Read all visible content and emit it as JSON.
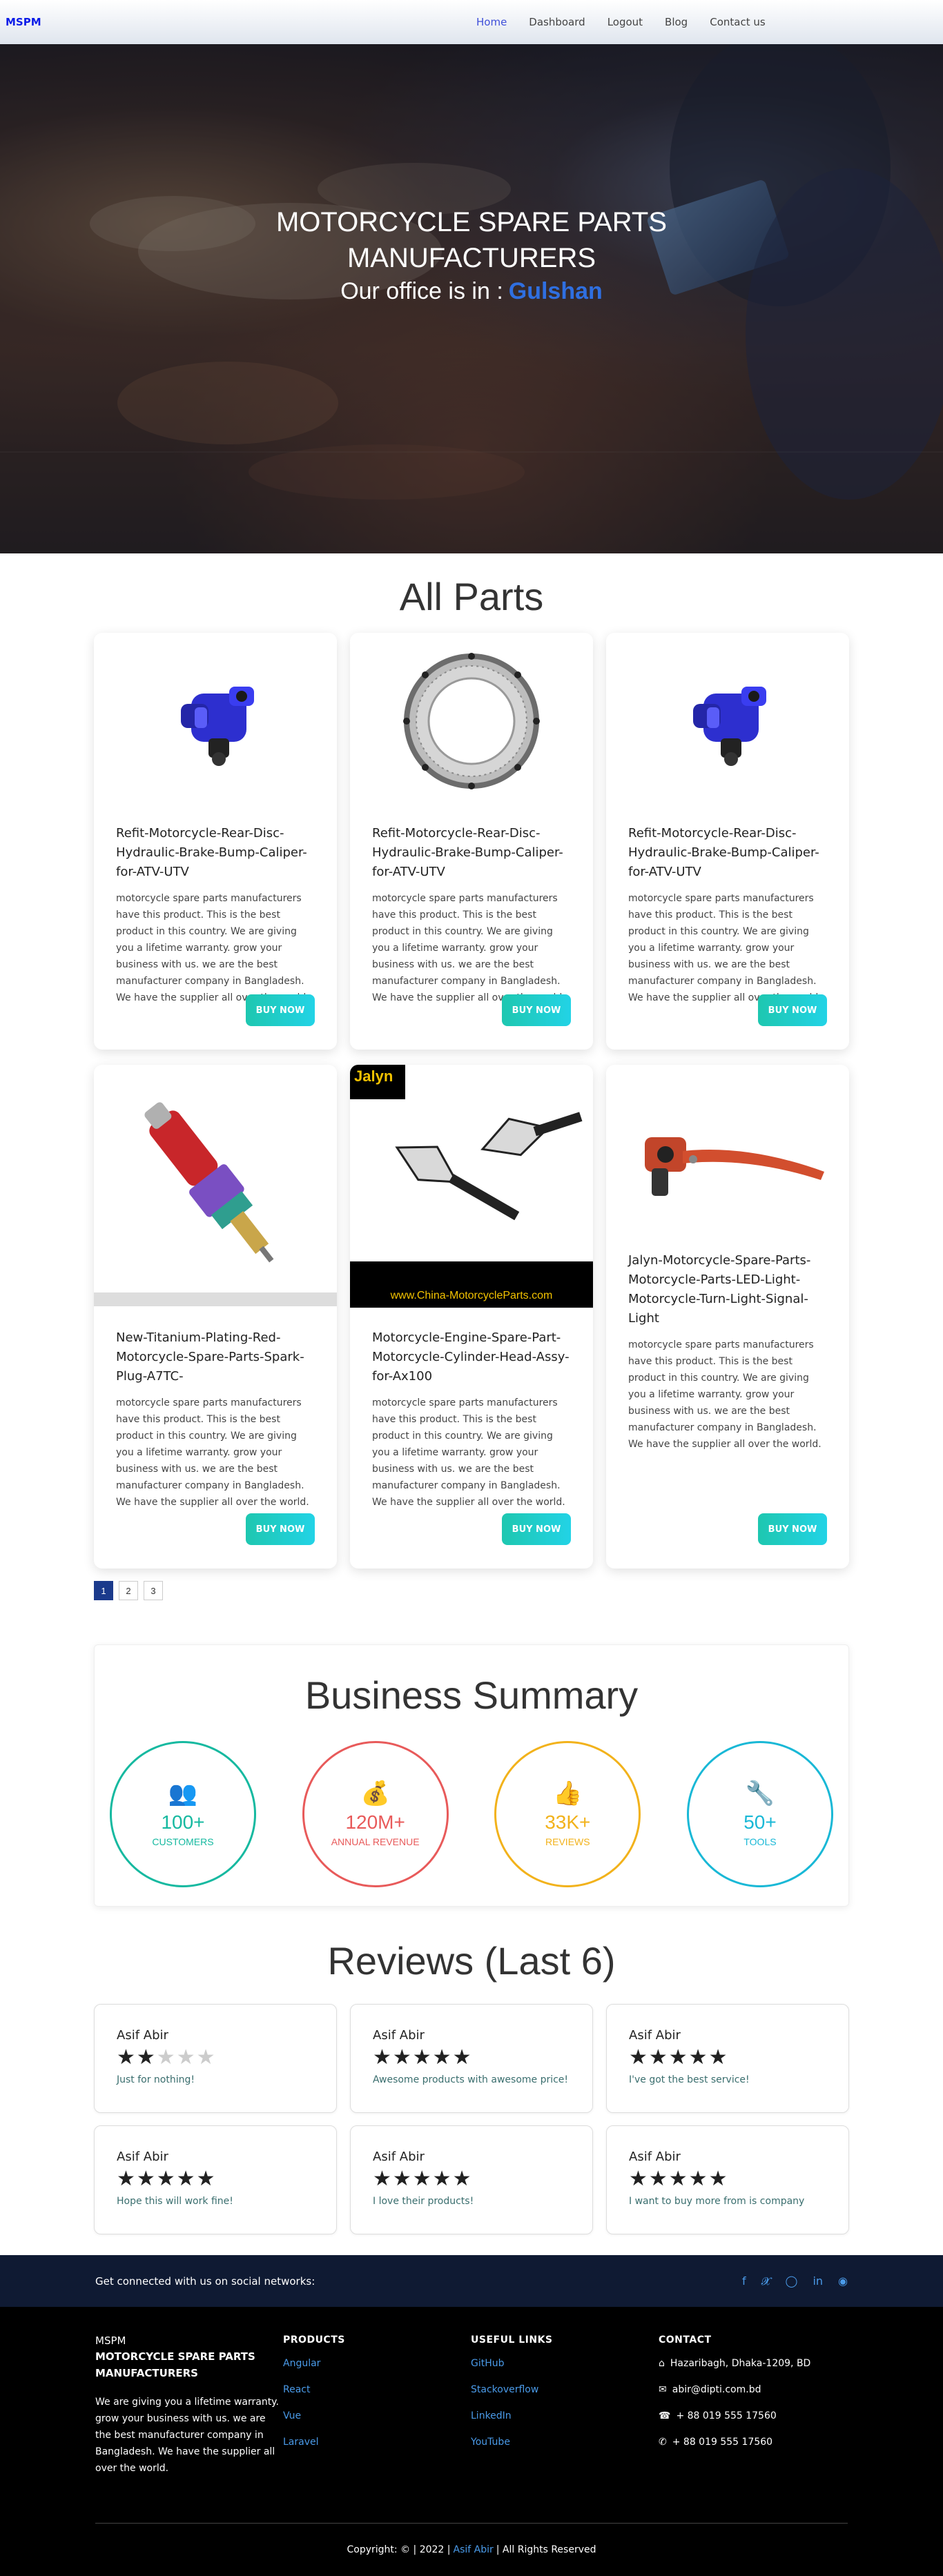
{
  "nav": {
    "brand": "MSPM",
    "links": [
      "Home",
      "Dashboard",
      "Logout",
      "Blog",
      "Contact us"
    ]
  },
  "hero": {
    "title_line1": "MOTORCYCLE SPARE PARTS",
    "title_line2": "MANUFACTURERS",
    "office_prefix": "Our office is in :",
    "office_city": "Gulshan"
  },
  "parts": {
    "title": "All Parts",
    "buy_label": "BUY NOW",
    "items": [
      {
        "name": "Refit-Motorcycle-Rear-Disc-Hydraulic-Brake-Bump-Caliper-for-ATV-UTV",
        "desc": "motorcycle spare parts manufacturers have this product. This is the best product in this country. We are giving you a lifetime warranty. grow your business with us. we are the best manufacturer company in Bangladesh. We have the supplier all over the world.",
        "icon": "caliper-image"
      },
      {
        "name": "Refit-Motorcycle-Rear-Disc-Hydraulic-Brake-Bump-Caliper-for-ATV-UTV",
        "desc": "motorcycle spare parts manufacturers have this product. This is the best product in this country. We are giving you a lifetime warranty. grow your business with us. we are the best manufacturer company in Bangladesh. We have the supplier all over the world.",
        "icon": "brake-disc-image"
      },
      {
        "name": "Refit-Motorcycle-Rear-Disc-Hydraulic-Brake-Bump-Caliper-for-ATV-UTV",
        "desc": "motorcycle spare parts manufacturers have this product. This is the best product in this country. We are giving you a lifetime warranty. grow your business with us. we are the best manufacturer company in Bangladesh. We have the supplier all over the world.",
        "icon": "caliper-image"
      },
      {
        "name": "New-Titanium-Plating-Red-Motorcycle-Spare-Parts-Spark-Plug-A7TC-",
        "desc": "motorcycle spare parts manufacturers have this product. This is the best product in this country. We are giving you a lifetime warranty. grow your business with us. we are the best manufacturer company in Bangladesh. We have the supplier all over the world.",
        "icon": "spark-plug-image"
      },
      {
        "name": "Motorcycle-Engine-Spare-Part-Motorcycle-Cylinder-Head-Assy-for-Ax100",
        "desc": "motorcycle spare parts manufacturers have this product. This is the best product in this country. We are giving you a lifetime warranty. grow your business with us. we are the best manufacturer company in Bangladesh. We have the supplier all over the world.",
        "icon": "turn-signal-image"
      },
      {
        "name": "Jalyn-Motorcycle-Spare-Parts-Motorcycle-Parts-LED-Light-Motorcycle-Turn-Light-Signal-Light",
        "desc": "motorcycle spare parts manufacturers have this product. This is the best product in this country. We are giving you a lifetime warranty. grow your business with us. we are the best manufacturer company in Bangladesh. We have the supplier all over the world.",
        "icon": "brake-lever-image"
      }
    ],
    "image_text": {
      "jalyn": "Jalyn",
      "china_url": "www.China-MotorcycleParts.com"
    }
  },
  "pagination": [
    "1",
    "2",
    "3"
  ],
  "summary": {
    "title": "Business Summary",
    "stats": [
      {
        "num": "100+",
        "label": "CUSTOMERS",
        "color": "#16b9a0",
        "icon": "people-icon"
      },
      {
        "num": "120M+",
        "label": "ANNUAL REVENUE",
        "color": "#e85a5a",
        "icon": "money-bag-icon"
      },
      {
        "num": "33K+",
        "label": "REVIEWS",
        "color": "#f2b21b",
        "icon": "thumbs-up-icon"
      },
      {
        "num": "50+",
        "label": "TOOLS",
        "color": "#19b8d6",
        "icon": "tools-icon"
      }
    ]
  },
  "reviews": {
    "title": "Reviews (Last 6)",
    "items": [
      {
        "name": "Asif Abir",
        "rating": 2,
        "text": "Just for nothing!"
      },
      {
        "name": "Asif Abir",
        "rating": 5,
        "text": "Awesome products with awesome price!"
      },
      {
        "name": "Asif Abir",
        "rating": 5,
        "text": "I've got the best service!"
      },
      {
        "name": "Asif Abir",
        "rating": 5,
        "text": "Hope this will work fine!"
      },
      {
        "name": "Asif Abir",
        "rating": 5,
        "text": "I love their products!"
      },
      {
        "name": "Asif Abir",
        "rating": 5,
        "text": "I want to buy more from is company"
      }
    ]
  },
  "social": {
    "text": "Get connected with us on social networks:",
    "icons": [
      "facebook-icon",
      "twitter-icon",
      "instagram-icon",
      "linkedin-icon",
      "github-icon"
    ]
  },
  "footer": {
    "brand": "MSPM",
    "brand_full": "MOTORCYCLE SPARE PARTS MANUFACTURERS",
    "about": "We are giving you a lifetime warranty. grow your business with us. we are the best manufacturer company in Bangladesh. We have the supplier all over the world.",
    "products_title": "PRODUCTS",
    "products": [
      "Angular",
      "React",
      "Vue",
      "Laravel"
    ],
    "links_title": "USEFUL LINKS",
    "links": [
      "GitHub",
      "Stackoverflow",
      "LinkedIn",
      "YouTube"
    ],
    "contact_title": "CONTACT",
    "address": "Hazaribagh, Dhaka-1209, BD",
    "email": "abir@dipti.com.bd",
    "phone": "+ 88 019 555 17560",
    "whatsapp": "+ 88 019 555 17560",
    "copyright_prefix": "Copyright: © | 2022 |",
    "copyright_author": "Asif Abir",
    "copyright_suffix": "| All Rights Reserved"
  }
}
